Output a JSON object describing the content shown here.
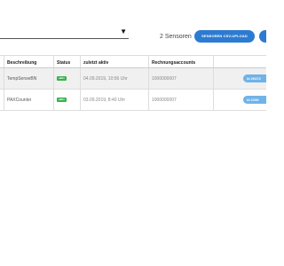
{
  "toolbar": {
    "filter_caret": "▼",
    "sensor_count": "2 Sensoren",
    "upload_button": "SENSOREN CSV-UPLOAD"
  },
  "table": {
    "headers": [
      "Beschreibung",
      "Status",
      "zuletzt aktiv",
      "Rechnungsaccounts"
    ],
    "rows": [
      {
        "description": "TempSenseBN",
        "status": "aktiv",
        "last_active": "04.09.2019, 10:56 Uhr",
        "account": "1000000007",
        "id": "ld 20472"
      },
      {
        "description": "PAXCounter",
        "status": "aktiv",
        "last_active": "03.09.2019, 8:40 Uhr",
        "account": "1000000007",
        "id": "ld 2196"
      }
    ]
  },
  "colors": {
    "primary_button": "#2d7bd1",
    "status_active": "#37b24d",
    "id_pill": "#6fb3e8",
    "row_highlight": "#f0f0f0"
  }
}
